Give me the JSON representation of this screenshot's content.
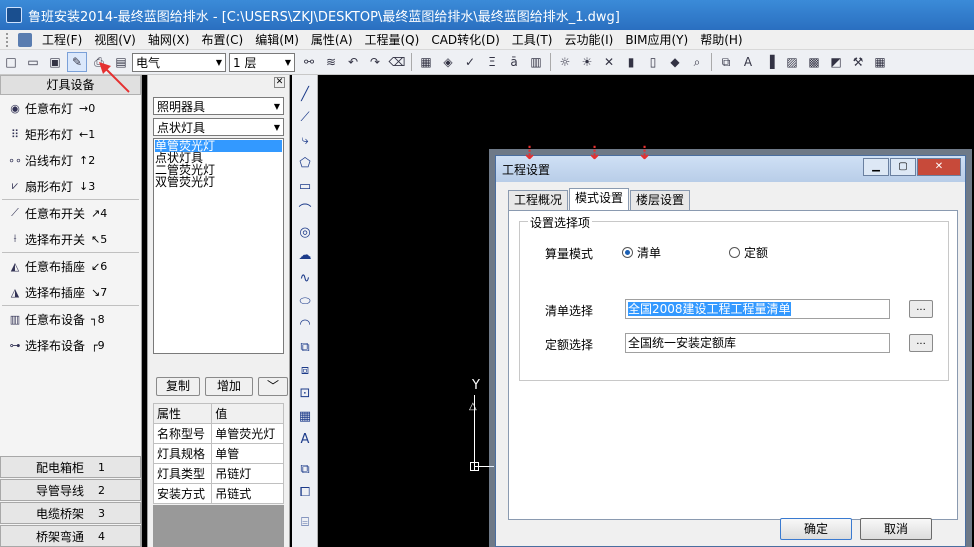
{
  "window": {
    "title": "鲁班安装2014-最终蓝图给排水 - [C:\\USERS\\ZKJ\\DESKTOP\\最终蓝图给排水\\最终蓝图给排水_1.dwg]"
  },
  "menu": [
    "工程(F)",
    "视图(V)",
    "轴网(X)",
    "布置(C)",
    "编辑(M)",
    "属性(A)",
    "工程量(Q)",
    "CAD转化(D)",
    "工具(T)",
    "云功能(I)",
    "BIM应用(Y)",
    "帮助(H)"
  ],
  "toolbar": {
    "discipline": "电气",
    "floor": "1 层"
  },
  "left_panel": {
    "header": "灯具设备",
    "commands": [
      {
        "label": "任意布灯",
        "key": "→0"
      },
      {
        "label": "矩形布灯",
        "key": "←1"
      },
      {
        "label": "沿线布灯",
        "key": "↑2"
      },
      {
        "label": "扇形布灯",
        "key": "↓3"
      },
      {
        "label": "任意布开关",
        "key": "↗4"
      },
      {
        "label": "选择布开关",
        "key": "↖5"
      },
      {
        "label": "任意布插座",
        "key": "↙6"
      },
      {
        "label": "选择布插座",
        "key": "↘7"
      },
      {
        "label": "任意布设备",
        "key": "┐8"
      },
      {
        "label": "选择布设备",
        "key": "┌9"
      }
    ],
    "bottom_tabs": [
      {
        "label": "配电箱柜",
        "num": "1"
      },
      {
        "label": "导管导线",
        "num": "2"
      },
      {
        "label": "电缆桥架",
        "num": "3"
      },
      {
        "label": "桥架弯通",
        "num": "4"
      }
    ]
  },
  "component_panel": {
    "category": "照明器具",
    "type": "点状灯具",
    "items": [
      "单管荧光灯",
      "点状灯具",
      "二管荧光灯",
      "双管荧光灯"
    ],
    "selected_index": 0,
    "copy_label": "复制",
    "add_label": "增加",
    "props_header": [
      "属性",
      "值"
    ],
    "props": [
      [
        "名称型号",
        "单管荧光灯"
      ],
      [
        "灯具规格",
        "单管"
      ],
      [
        "灯具类型",
        "吊链灯"
      ],
      [
        "安装方式",
        "吊链式"
      ]
    ]
  },
  "canvas": {
    "ucs_label": "Y"
  },
  "dialog": {
    "title": "工程设置",
    "tabs": [
      "工程概况",
      "模式设置",
      "楼层设置"
    ],
    "active_tab": 1,
    "group_label": "设置选择项",
    "mode_label": "算量模式",
    "mode_options": [
      "清单",
      "定额"
    ],
    "mode_selected": 0,
    "bill_label": "清单选择",
    "bill_value": "全国2008建设工程工程量清单",
    "quota_label": "定额选择",
    "quota_value": "全国统一安装定额库",
    "browse_label": "...",
    "ok_label": "确定",
    "cancel_label": "取消"
  },
  "watermark": {
    "text": "Bai 经验",
    "sub": "jingyan.baidu.com"
  }
}
